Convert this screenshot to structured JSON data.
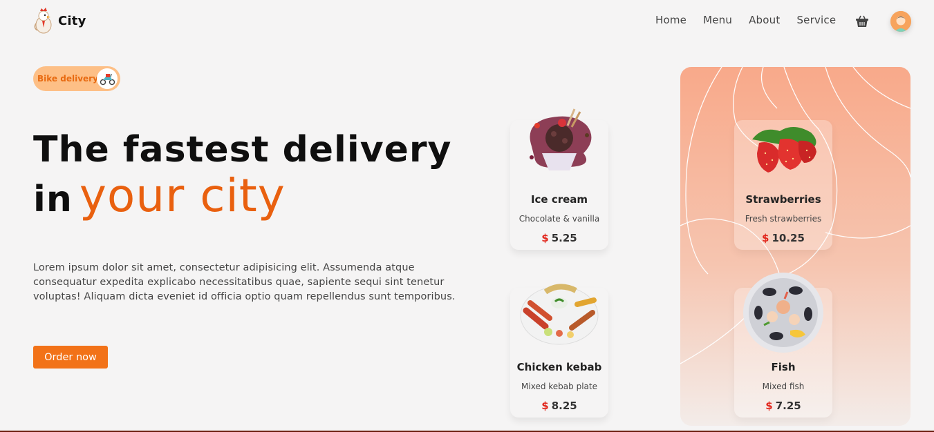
{
  "brand": {
    "name": "City"
  },
  "nav": {
    "items": [
      "Home",
      "Menu",
      "About",
      "Service"
    ]
  },
  "badge": {
    "label": "Bike delivery"
  },
  "hero": {
    "title_line1": "The fastest delivery",
    "title_line2_prefix": "in",
    "title_line2_accent": "your city",
    "description": "Lorem ipsum dolor sit amet, consectetur adipisicing elit. Assumenda atque consequatur expedita explicabo necessitatibus quae, sapiente sequi sint tenetur voluptas! Aliquam dicta eveniet id officia optio quam repellendus sunt temporibus.",
    "cta": "Order now"
  },
  "currency": "$",
  "cards": [
    {
      "title": "Ice cream",
      "subtitle": "Chocolate & vanilla",
      "price": "5.25"
    },
    {
      "title": "Strawberries",
      "subtitle": "Fresh strawberries",
      "price": "10.25"
    },
    {
      "title": "Chicken kebab",
      "subtitle": "Mixed kebab plate",
      "price": "8.25"
    },
    {
      "title": "Fish",
      "subtitle": "Mixed fish",
      "price": "7.25"
    }
  ],
  "colors": {
    "accent": "#e9600f",
    "button": "#f27218",
    "price_symbol": "#e1261c",
    "badge_bg": "#fdbf86",
    "panel_top": "#f8a98a"
  }
}
